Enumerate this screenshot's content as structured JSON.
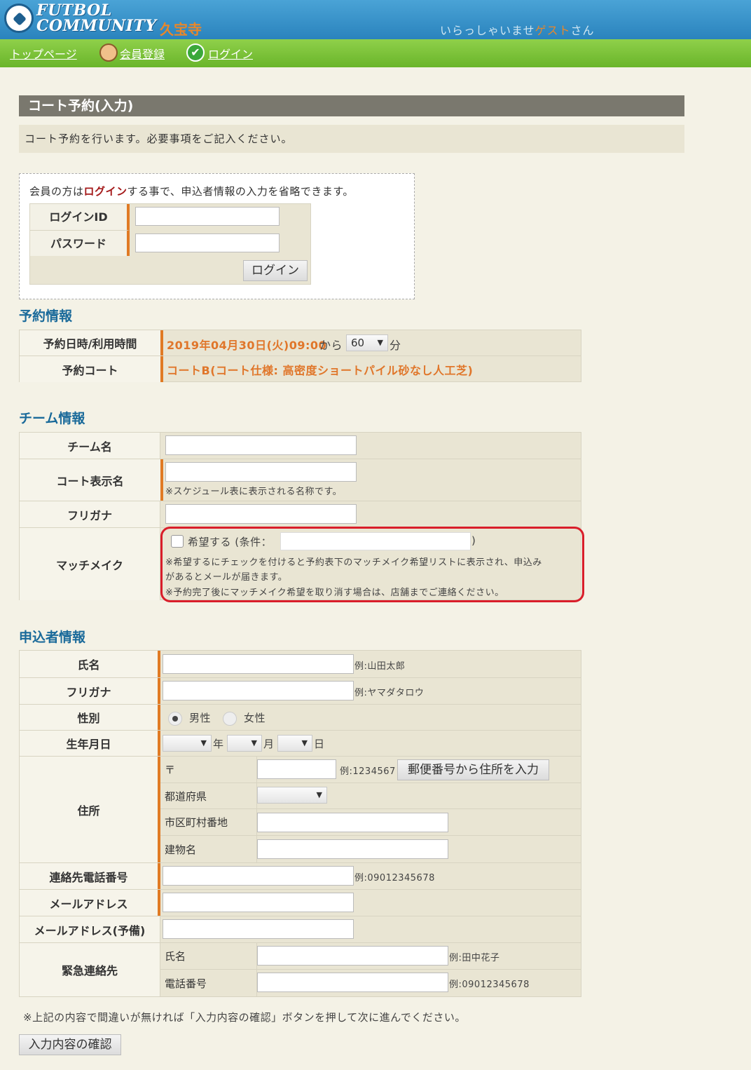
{
  "header": {
    "logo_line1": "FUTBOL",
    "logo_line2": "COMMUNITY",
    "store_name": "久宝寺",
    "welcome_prefix": "いらっしゃいませ",
    "welcome_user": "ゲスト",
    "welcome_suffix": "さん"
  },
  "nav": {
    "top_page": "トップページ",
    "register": "会員登録",
    "login": "ログイン"
  },
  "page": {
    "title": "コート予約(入力)",
    "description": "コート予約を行います。必要事項をご記入ください。"
  },
  "login_box": {
    "note_prefix": "会員の方は",
    "note_link": "ログイン",
    "note_suffix": "する事で、申込者情報の入力を省略できます。",
    "id_label": "ログインID",
    "password_label": "パスワード",
    "login_button": "ログイン"
  },
  "reservation": {
    "heading": "予約情報",
    "datetime_label": "予約日時/利用時間",
    "datetime_value": "2019年04月30日(火)09:00",
    "from_text": "から",
    "duration": "60",
    "minutes_unit": "分",
    "court_label": "予約コート",
    "court_value": "コートB(コート仕様: 高密度ショートパイル砂なし人工芝)"
  },
  "team": {
    "heading": "チーム情報",
    "team_name_label": "チーム名",
    "court_display_label": "コート表示名",
    "court_display_note": "※スケジュール表に表示される名称です。",
    "furigana_label": "フリガナ",
    "match_label": "マッチメイク",
    "match_check_label": "希望する (条件：",
    "match_close": ")",
    "match_note1": "※希望するにチェックを付けると予約表下のマッチメイク希望リストに表示され、申込み",
    "match_note2": "があるとメールが届きます。",
    "match_note3": "※予約完了後にマッチメイク希望を取り消す場合は、店舗までご連絡ください。"
  },
  "applicant": {
    "heading": "申込者情報",
    "name_label": "氏名",
    "name_example": "例:山田太郎",
    "kana_label": "フリガナ",
    "kana_example": "例:ヤマダタロウ",
    "gender_label": "性別",
    "male": "男性",
    "female": "女性",
    "birth_label": "生年月日",
    "year_unit": "年",
    "month_unit": "月",
    "day_unit": "日",
    "address_label": "住所",
    "postal_label": "〒",
    "postal_example": "例:1234567",
    "postal_button": "郵便番号から住所を入力",
    "pref_label": "都道府県",
    "city_label": "市区町村番地",
    "building_label": "建物名",
    "phone_label": "連絡先電話番号",
    "phone_example": "例:09012345678",
    "email_label": "メールアドレス",
    "email2_label": "メールアドレス(予備)",
    "emergency_label": "緊急連絡先",
    "em_name_label": "氏名",
    "em_name_example": "例:田中花子",
    "em_phone_label": "電話番号",
    "em_phone_example": "例:09012345678"
  },
  "footer": {
    "note": "※上記の内容で間違いが無ければ「入力内容の確認」ボタンを押して次に進んでください。",
    "confirm_button": "入力内容の確認"
  },
  "colors": {
    "header_blue": "#2a83bd",
    "nav_green": "#6ab52a",
    "accent_orange": "#e07a24",
    "heading_blue": "#1a6a9a",
    "highlight_red": "#d91e2a"
  },
  "icons": [
    "soccer-ball-logo-icon",
    "member-icon",
    "check-icon"
  ]
}
